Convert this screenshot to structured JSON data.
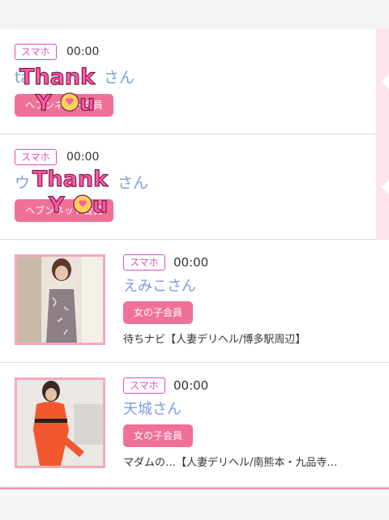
{
  "items": [
    {
      "badge": "スマホ",
      "time": "00:00",
      "name_prefix": "ta",
      "name_suffix": "さん",
      "member": "ヘブンネット会員",
      "stamp": "Thank You"
    },
    {
      "badge": "スマホ",
      "time": "00:00",
      "name_prefix": "ウ",
      "name_suffix": "さん",
      "member": "ヘブンネット会員",
      "stamp": "Thank You"
    },
    {
      "badge": "スマホ",
      "time": "00:00",
      "name": "えみこさん",
      "member": "女の子会員",
      "shop": "待ちナビ【人妻デリヘル/博多駅周辺】"
    },
    {
      "badge": "スマホ",
      "time": "00:00",
      "name": "天城さん",
      "member": "女の子会員",
      "shop": "マダムの…【人妻デリヘル/南熊本・九品寺…"
    }
  ]
}
